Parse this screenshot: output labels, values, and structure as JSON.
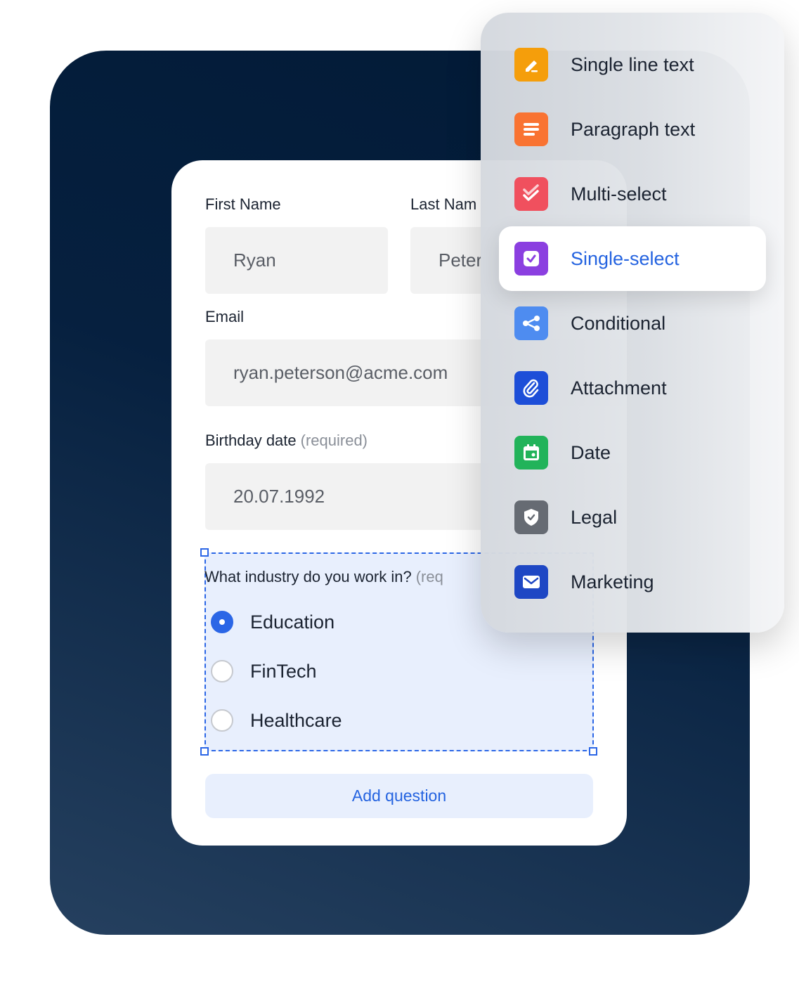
{
  "form": {
    "first_name_label": "First Name",
    "first_name_value": "Ryan",
    "last_name_label": "Last Nam",
    "last_name_value": "Peter",
    "email_label": "Email",
    "email_value": "ryan.peterson@acme.com",
    "birthday_label": "Birthday date",
    "birthday_note": "(required)",
    "birthday_value": "20.07.1992",
    "question_text": "What industry do you work in?",
    "question_note": "(req",
    "options": [
      {
        "label": "Education",
        "checked": true
      },
      {
        "label": "FinTech",
        "checked": false
      },
      {
        "label": "Healthcare",
        "checked": false
      }
    ],
    "add_question_label": "Add question"
  },
  "menu": {
    "items": [
      {
        "label": "Single line text",
        "icon": "pencil-icon",
        "color": "#f59e0b"
      },
      {
        "label": "Paragraph text",
        "icon": "paragraph-icon",
        "color": "#f97332"
      },
      {
        "label": "Multi-select",
        "icon": "double-check-icon",
        "color": "#f0505e"
      },
      {
        "label": "Single-select",
        "icon": "checkbox-icon",
        "color": "#8b3fe0",
        "active": true
      },
      {
        "label": "Conditional",
        "icon": "share-nodes-icon",
        "color": "#4e8cf0"
      },
      {
        "label": "Attachment",
        "icon": "paperclip-icon",
        "color": "#1d4ed8"
      },
      {
        "label": "Date",
        "icon": "calendar-icon",
        "color": "#22b35a"
      },
      {
        "label": "Legal",
        "icon": "shield-icon",
        "color": "#666b73"
      },
      {
        "label": "Marketing",
        "icon": "envelope-icon",
        "color": "#1e47c4"
      }
    ]
  },
  "colors": {
    "accent": "#2b66e6",
    "panel_dark": "#021a36"
  }
}
